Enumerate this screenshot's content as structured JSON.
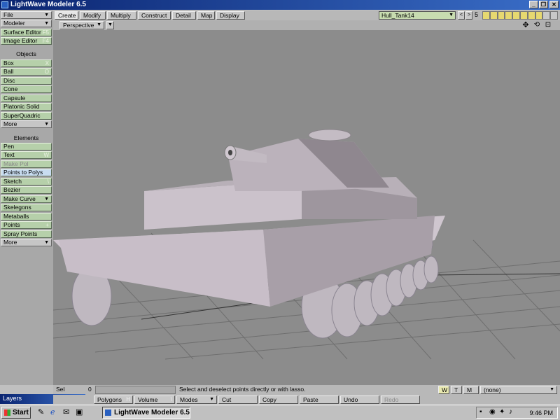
{
  "window": {
    "title": "LightWave Modeler 6.5",
    "controls": [
      "_",
      "❐",
      "✕"
    ]
  },
  "left_panel": {
    "top_items": [
      {
        "label": "File",
        "arrow": true
      },
      {
        "label": "Modeler",
        "arrow": true
      },
      {
        "label": "Surface Editor",
        "shortcut": "F5"
      },
      {
        "label": "Image Editor",
        "shortcut": "F4"
      }
    ],
    "objects_header": "Objects",
    "objects": [
      {
        "label": "Box",
        "shortcut": "X"
      },
      {
        "label": "Ball",
        "shortcut": "O"
      },
      {
        "label": "Disc",
        "shortcut": ""
      },
      {
        "label": "Cone",
        "shortcut": ""
      },
      {
        "label": "Capsule",
        "shortcut": ""
      },
      {
        "label": "Platonic Solid",
        "shortcut": ""
      },
      {
        "label": "SuperQuadric",
        "shortcut": ""
      },
      {
        "label": "More",
        "arrow": true
      }
    ],
    "elements_header": "Elements",
    "elements": [
      {
        "label": "Pen",
        "shortcut": ""
      },
      {
        "label": "Text",
        "shortcut": "W"
      },
      {
        "label": "Make Pol",
        "shortcut": "",
        "dim": true
      },
      {
        "label": "Points to Polys",
        "shortcut": "",
        "hl": true
      },
      {
        "label": "Sketch",
        "shortcut": "\\"
      },
      {
        "label": "Bezier",
        "shortcut": ""
      },
      {
        "label": "Make Curve",
        "arrow": true
      },
      {
        "label": "Skelegons",
        "shortcut": ""
      },
      {
        "label": "Metaballs",
        "shortcut": ""
      },
      {
        "label": "Points",
        "shortcut": "+"
      },
      {
        "label": "Spray Points",
        "shortcut": ""
      },
      {
        "label": "More",
        "arrow": true
      }
    ]
  },
  "tabs": [
    "Create",
    "Modify",
    "Multiply",
    "Construct",
    "Detail",
    "Map",
    "Display"
  ],
  "active_tab": "Create",
  "object_selector": {
    "value": "Hull_Tank14"
  },
  "layer_controls": {
    "nav": [
      "<",
      ">"
    ],
    "count": "5"
  },
  "viewport": {
    "mode": "Perspective"
  },
  "status": {
    "sel_label": "Sel",
    "sel_count": "0",
    "message": "Select and deselect points directly or with lasso.",
    "wtm": [
      "W",
      "T",
      "M"
    ],
    "surface": "(none)"
  },
  "commands": [
    {
      "label": "Polygons",
      "shortcut": "H"
    },
    {
      "label": "Volume",
      "shortcut": "\\"
    },
    {
      "label": "Modes",
      "arrow": true
    },
    {
      "label": "Cut",
      "shortcut": ""
    },
    {
      "label": "Copy",
      "shortcut": ""
    },
    {
      "label": "Paste",
      "shortcut": ""
    },
    {
      "label": "Undo",
      "shortcut": ""
    },
    {
      "label": "Redo",
      "shortcut": "",
      "dim": true
    }
  ],
  "layers_window": {
    "title": "Layers"
  },
  "taskbar": {
    "start": "Start",
    "task": "LightWave Modeler 6.5",
    "clock": "9:46 PM"
  },
  "colors": {
    "title_start": "#0a2470",
    "button_green": "#b6d0aa",
    "viewport": "#8c8c8c"
  }
}
